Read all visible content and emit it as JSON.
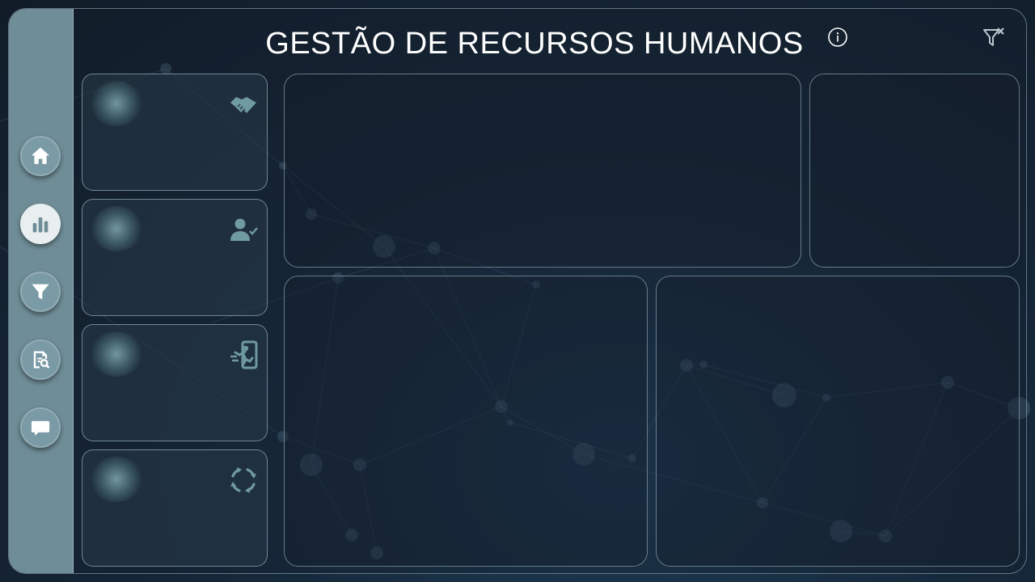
{
  "header": {
    "title": "GESTÃO DE RECURSOS HUMANOS",
    "info_icon": "info-circle-icon",
    "clear_filters_icon": "clear-filter-icon"
  },
  "sidebar": {
    "items": [
      {
        "name": "home",
        "icon": "home-icon",
        "active": false
      },
      {
        "name": "charts",
        "icon": "bar-chart-icon",
        "active": true
      },
      {
        "name": "filters",
        "icon": "filter-icon",
        "active": false
      },
      {
        "name": "report",
        "icon": "report-search-icon",
        "active": false
      },
      {
        "name": "comments",
        "icon": "chat-icon",
        "active": false
      }
    ]
  },
  "kpi_cards": [
    {
      "icon": "handshake-icon"
    },
    {
      "icon": "user-check-icon"
    },
    {
      "icon": "employee-exit-icon"
    },
    {
      "icon": "turnover-cycle-icon"
    }
  ],
  "colors": {
    "sidebar": "#6f8d97",
    "icon_muted": "#6f9aa0",
    "background": "#16283a",
    "title": "#ffffff"
  }
}
